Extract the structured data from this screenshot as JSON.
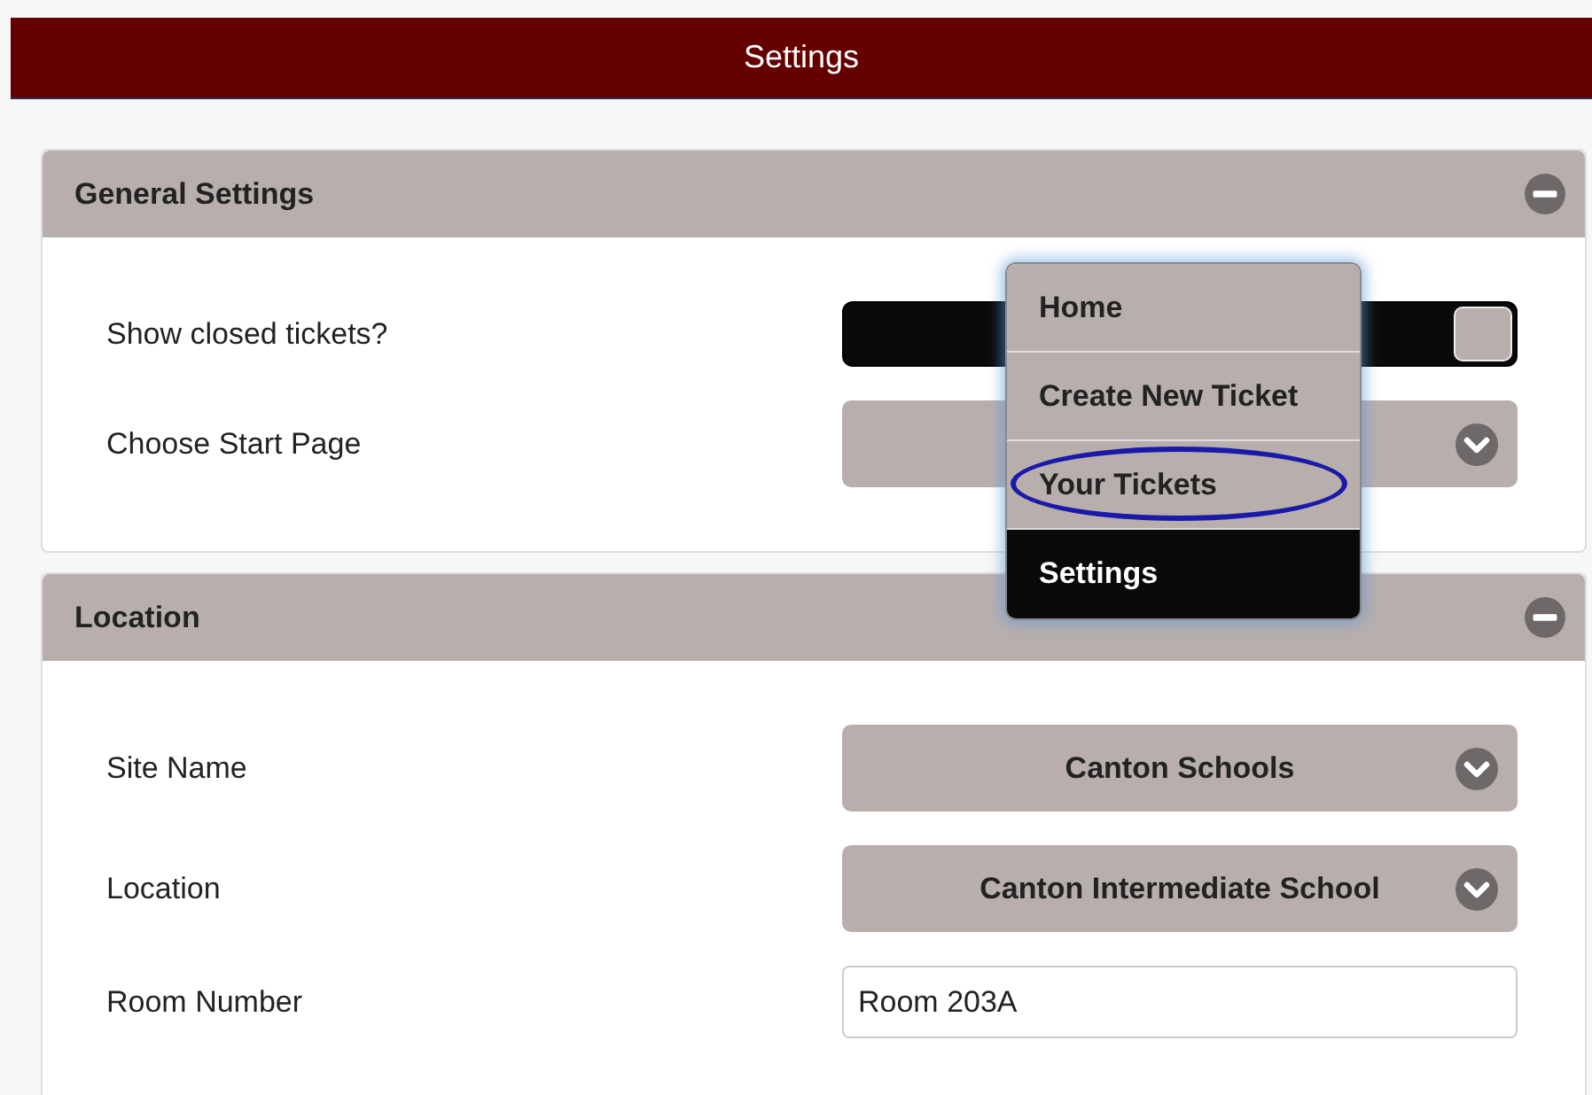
{
  "header": {
    "title": "Settings"
  },
  "sections": [
    {
      "title": "General Settings",
      "expanded": true,
      "rows": [
        {
          "kind": "toggle",
          "label": "Show closed tickets?",
          "on": true
        },
        {
          "kind": "select",
          "label": "Choose Start Page"
        }
      ]
    },
    {
      "title": "Location",
      "expanded": true,
      "rows": [
        {
          "kind": "select",
          "label": "Site Name",
          "value": "Canton Schools"
        },
        {
          "kind": "select",
          "label": "Location",
          "value": "Canton Intermediate School"
        },
        {
          "kind": "text",
          "label": "Room Number",
          "value": "Room 203A"
        }
      ]
    }
  ],
  "start_page_menu": {
    "items": [
      {
        "label": "Home",
        "selected": false,
        "circled": false
      },
      {
        "label": "Create New Ticket",
        "selected": false,
        "circled": false
      },
      {
        "label": "Your Tickets",
        "selected": false,
        "circled": true
      },
      {
        "label": "Settings",
        "selected": true,
        "circled": false
      }
    ]
  }
}
